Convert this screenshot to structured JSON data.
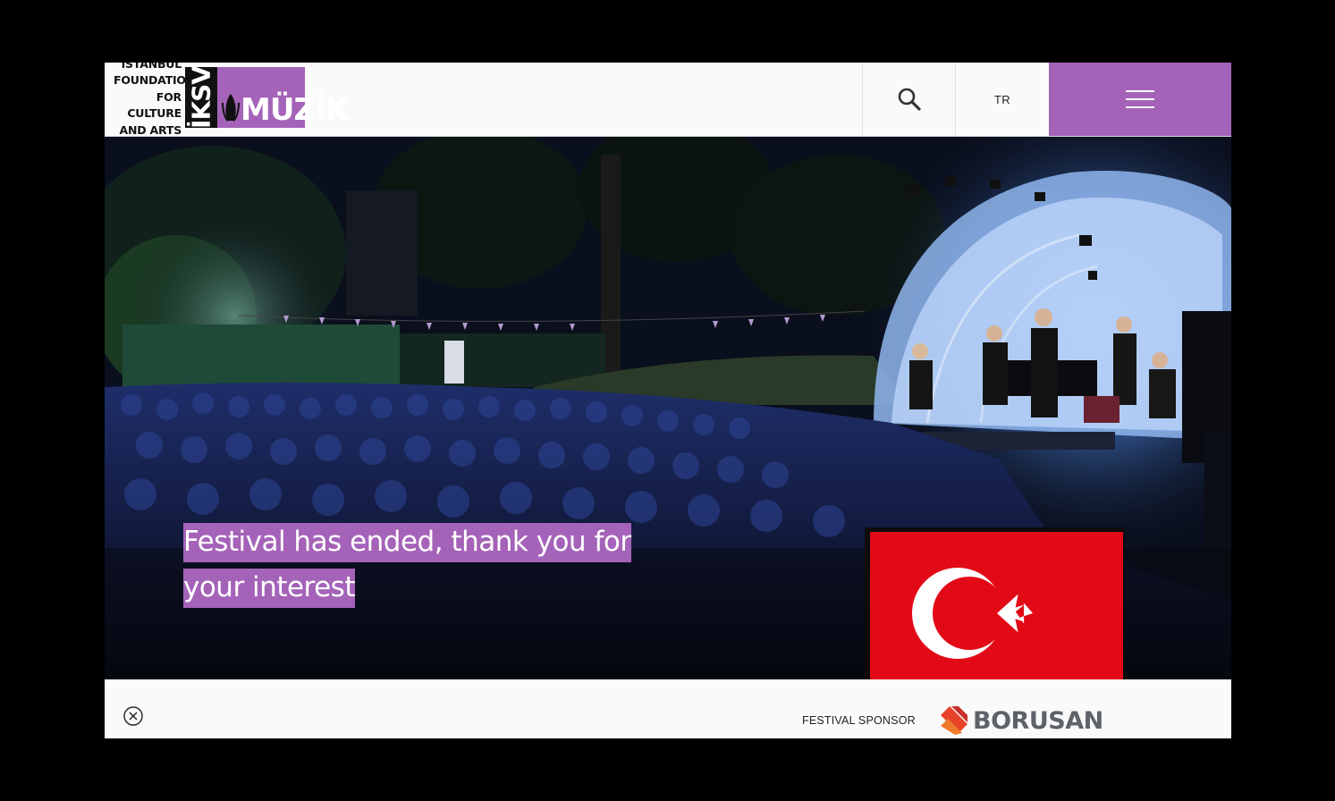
{
  "header": {
    "logo_lines": [
      "ISTANBUL",
      "FOUNDATION",
      "FOR CULTURE",
      "AND ARTS"
    ],
    "logo_mark": "İKSV",
    "logo_product": "MÜZİK",
    "search_icon": "search-icon",
    "lang_label": "TR",
    "menu_icon": "hamburger-menu-icon"
  },
  "hero": {
    "headline": "Festival has ended, thank you for your interest",
    "flag": "turkey-flag"
  },
  "sponsor": {
    "close_icon": "close-circle-icon",
    "label": "FESTIVAL SPONSOR",
    "brand": "BORUSAN"
  },
  "colors": {
    "accent": "#a463b8",
    "flag_red": "#e30a17",
    "brand_orange": "#e8432a"
  }
}
